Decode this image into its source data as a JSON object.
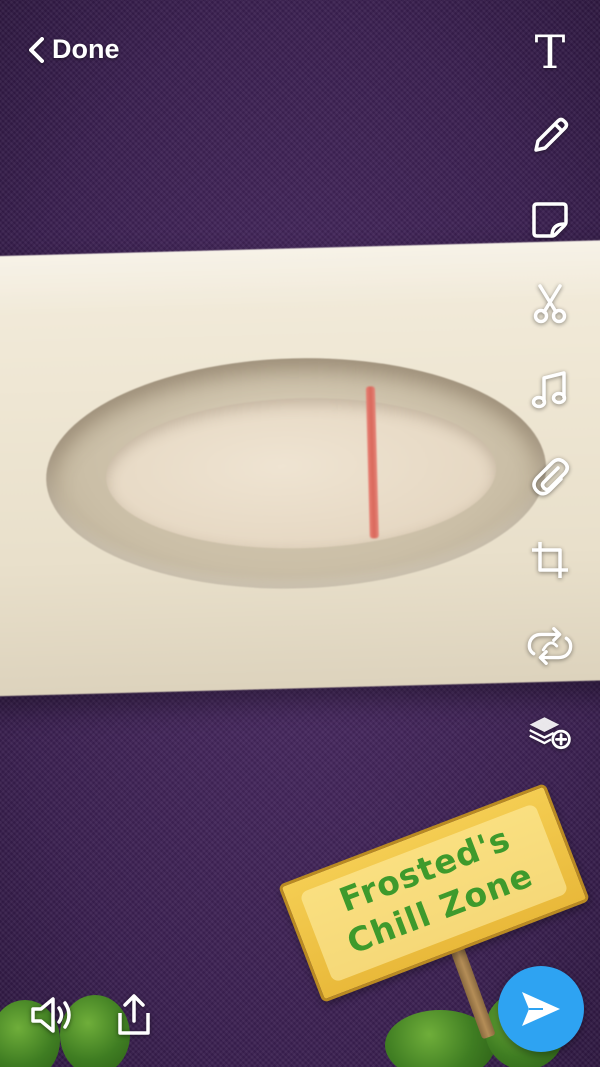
{
  "header": {
    "done_label": "Done"
  },
  "toolbar": {
    "text_glyph": "T",
    "tools": [
      "text-tool",
      "pencil-tool",
      "sticker-tool",
      "scissors-tool",
      "music-tool",
      "attachment-tool",
      "crop-tool",
      "loop-tool",
      "layers-add-tool"
    ]
  },
  "sticker": {
    "line1": "Frosted's",
    "line2": "Chill Zone"
  },
  "colors": {
    "send_button": "#2ea3f2",
    "sticker_text": "#3e9a2c",
    "sign_board": "#f4cd52",
    "test_line": "#d9685b",
    "background": "#3f2356"
  }
}
